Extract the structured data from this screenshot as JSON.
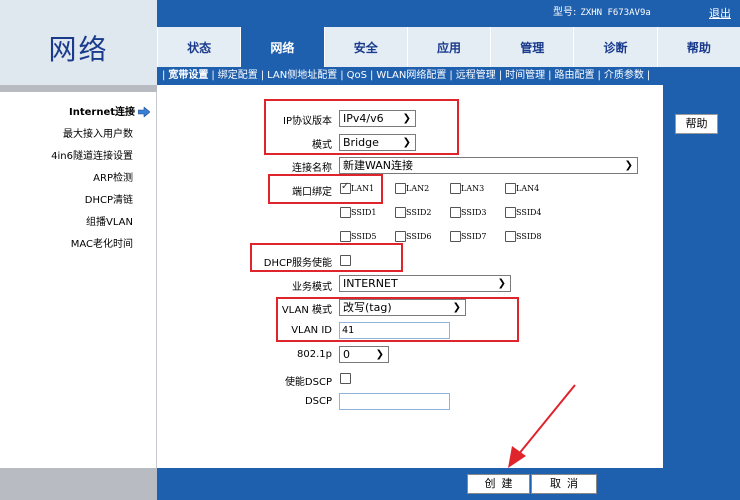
{
  "header": {
    "logo": "网络",
    "model_label": "型号:",
    "model_value": "ZXHN F673AV9a",
    "logout": "退出"
  },
  "main_tabs": [
    {
      "label": "状态"
    },
    {
      "label": "网络"
    },
    {
      "label": "安全"
    },
    {
      "label": "应用"
    },
    {
      "label": "管理"
    },
    {
      "label": "诊断"
    },
    {
      "label": "帮助"
    }
  ],
  "active_main_tab": "网络",
  "sub_nav": [
    {
      "label": "宽带设置"
    },
    {
      "label": "绑定配置"
    },
    {
      "label": "LAN侧地址配置"
    },
    {
      "label": "QoS"
    },
    {
      "label": "WLAN网络配置"
    },
    {
      "label": "远程管理"
    },
    {
      "label": "时间管理"
    },
    {
      "label": "路由配置"
    },
    {
      "label": "介质参数"
    }
  ],
  "left_nav": [
    {
      "label": "Internet连接"
    },
    {
      "label": "最大接入用户数"
    },
    {
      "label": "4in6隧道连接设置"
    },
    {
      "label": "ARP检测"
    },
    {
      "label": "DHCP清链"
    },
    {
      "label": "组播VLAN"
    },
    {
      "label": "MAC老化时间"
    }
  ],
  "form": {
    "ip_version_label": "IP协议版本",
    "ip_version_value": "IPv4/v6",
    "mode_label": "模式",
    "mode_value": "Bridge",
    "conn_name_label": "连接名称",
    "conn_name_value": "新建WAN连接",
    "port_bind_label": "端口绑定",
    "ports_row1": [
      {
        "label": "LAN1",
        "checked": true
      },
      {
        "label": "LAN2",
        "checked": false
      },
      {
        "label": "LAN3",
        "checked": false
      },
      {
        "label": "LAN4",
        "checked": false
      }
    ],
    "ports_row2": [
      {
        "label": "SSID1",
        "checked": false
      },
      {
        "label": "SSID2",
        "checked": false
      },
      {
        "label": "SSID3",
        "checked": false
      },
      {
        "label": "SSID4",
        "checked": false
      }
    ],
    "ports_row3": [
      {
        "label": "SSID5",
        "checked": false
      },
      {
        "label": "SSID6",
        "checked": false
      },
      {
        "label": "SSID7",
        "checked": false
      },
      {
        "label": "SSID8",
        "checked": false
      }
    ],
    "dhcp_label": "DHCP服务使能",
    "dhcp_checked": false,
    "service_mode_label": "业务模式",
    "service_mode_value": "INTERNET",
    "vlan_mode_label": "VLAN 模式",
    "vlan_mode_value": "改写(tag)",
    "vlan_id_label": "VLAN ID",
    "vlan_id_value": "41",
    "p8021_label": "802.1p",
    "p8021_value": "0",
    "dscp_enable_label": "使能DSCP",
    "dscp_enable_checked": false,
    "dscp_label": "DSCP",
    "dscp_value": ""
  },
  "buttons": {
    "help": "帮助",
    "create": "创建",
    "cancel": "取消"
  },
  "colors": {
    "brand_blue": "#1e5fae",
    "highlight_red": "#e0242c"
  }
}
